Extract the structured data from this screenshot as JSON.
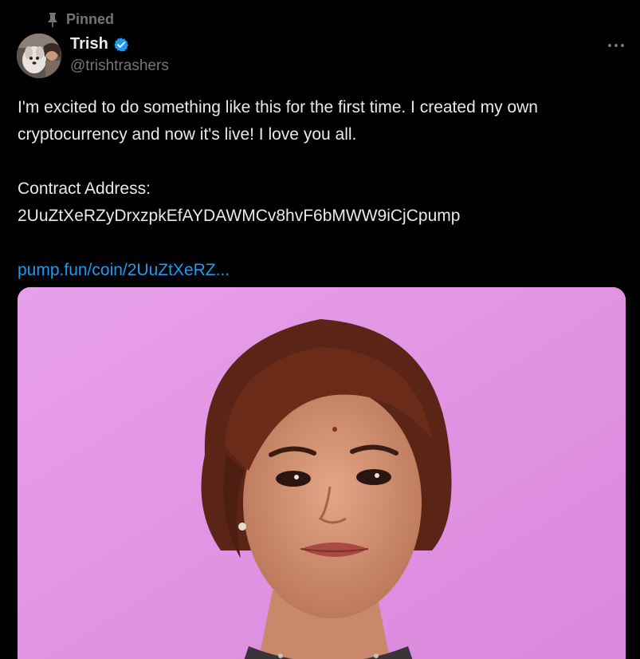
{
  "pinned": {
    "label": "Pinned",
    "icon": "pin-icon"
  },
  "author": {
    "display_name": "Trish",
    "handle": "@trishtrashers",
    "verified": true,
    "verified_color": "#1d9bf0"
  },
  "menu": {
    "icon": "more-horizontal-icon"
  },
  "tweet": {
    "line1": "I'm excited to do something like this for the first time. I created my own",
    "line2": "cryptocurrency and now it's live! I love you all.",
    "contract_label": "Contract Address:",
    "contract_address": "2UuZtXeRZyDrxzpkEfAYDAWMCv8hvF6bMWW9iCjCpump",
    "link_text": "pump.fun/coin/2UuZtXeRZ..."
  },
  "colors": {
    "background": "#000000",
    "text_primary": "#e7e9ea",
    "text_secondary": "#71767b",
    "link": "#1d9bf0",
    "media_background": "#e79ae6"
  }
}
